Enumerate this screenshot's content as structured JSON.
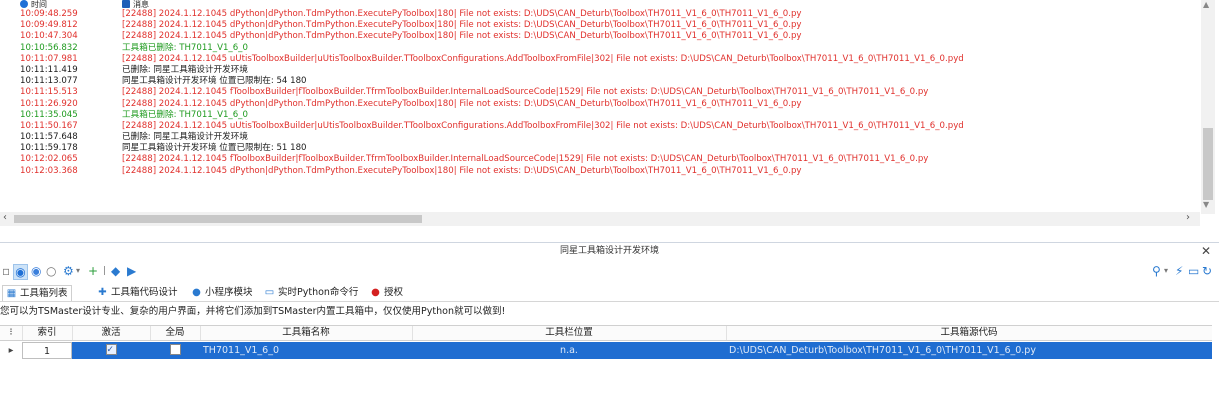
{
  "log": {
    "header_time": "时间",
    "header_msg": "消息",
    "lines": [
      {
        "time": "10:09:48.259",
        "msg": "[22488] 2024.1.12.1045 dPython|dPython.TdmPython.ExecutePyToolbox|180| File not exists: D:\\UDS\\CAN_Deturb\\Toolbox\\TH7011_V1_6_0\\TH7011_V1_6_0.py",
        "level": "red"
      },
      {
        "time": "10:09:49.812",
        "msg": "[22488] 2024.1.12.1045 dPython|dPython.TdmPython.ExecutePyToolbox|180| File not exists: D:\\UDS\\CAN_Deturb\\Toolbox\\TH7011_V1_6_0\\TH7011_V1_6_0.py",
        "level": "red"
      },
      {
        "time": "10:10:47.304",
        "msg": "[22488] 2024.1.12.1045 dPython|dPython.TdmPython.ExecutePyToolbox|180| File not exists: D:\\UDS\\CAN_Deturb\\Toolbox\\TH7011_V1_6_0\\TH7011_V1_6_0.py",
        "level": "red"
      },
      {
        "time": "10:10:56.832",
        "msg": "工具箱已删除: TH7011_V1_6_0",
        "level": "green"
      },
      {
        "time": "10:11:07.981",
        "msg": "[22488] 2024.1.12.1045 uUtisToolboxBuilder|uUtisToolboxBuilder.TToolboxConfigurations.AddToolboxFromFile|302| File not exists: D:\\UDS\\CAN_Deturb\\Toolbox\\TH7011_V1_6_0\\TH7011_V1_6_0.pyd",
        "level": "red"
      },
      {
        "time": "10:11:11.419",
        "msg": "已删除: 同星工具箱设计开发环境",
        "level": "black"
      },
      {
        "time": "10:11:13.077",
        "msg": "同星工具箱设计开发环境 位置已限制在: 54 180",
        "level": "black"
      },
      {
        "time": "10:11:15.513",
        "msg": "[22488] 2024.1.12.1045 fToolboxBuilder|fToolboxBuilder.TfrmToolboxBuilder.InternalLoadSourceCode|1529| File not exists: D:\\UDS\\CAN_Deturb\\Toolbox\\TH7011_V1_6_0\\TH7011_V1_6_0.py",
        "level": "red"
      },
      {
        "time": "10:11:26.920",
        "msg": "[22488] 2024.1.12.1045 dPython|dPython.TdmPython.ExecutePyToolbox|180| File not exists: D:\\UDS\\CAN_Deturb\\Toolbox\\TH7011_V1_6_0\\TH7011_V1_6_0.py",
        "level": "red"
      },
      {
        "time": "10:11:35.045",
        "msg": "工具箱已删除: TH7011_V1_6_0",
        "level": "green"
      },
      {
        "time": "10:11:50.167",
        "msg": "[22488] 2024.1.12.1045 uUtisToolboxBuilder|uUtisToolboxBuilder.TToolboxConfigurations.AddToolboxFromFile|302| File not exists: D:\\UDS\\CAN_Deturb\\Toolbox\\TH7011_V1_6_0\\TH7011_V1_6_0.pyd",
        "level": "red"
      },
      {
        "time": "10:11:57.648",
        "msg": "已删除: 同星工具箱设计开发环境",
        "level": "black"
      },
      {
        "time": "10:11:59.178",
        "msg": "同星工具箱设计开发环境 位置已限制在: 51 180",
        "level": "black"
      },
      {
        "time": "10:12:02.065",
        "msg": "[22488] 2024.1.12.1045 fToolboxBuilder|fToolboxBuilder.TfrmToolboxBuilder.InternalLoadSourceCode|1529| File not exists: D:\\UDS\\CAN_Deturb\\Toolbox\\TH7011_V1_6_0\\TH7011_V1_6_0.py",
        "level": "red"
      },
      {
        "time": "10:12:03.368",
        "msg": "[22488] 2024.1.12.1045 dPython|dPython.TdmPython.ExecutePyToolbox|180| File not exists: D:\\UDS\\CAN_Deturb\\Toolbox\\TH7011_V1_6_0\\TH7011_V1_6_0.py",
        "level": "red"
      }
    ]
  },
  "panel": {
    "title": "同星工具箱设计开发环境",
    "tabs": [
      {
        "label": "工具箱列表",
        "icon": "toolbox-icon",
        "active": true
      },
      {
        "label": "工具箱代码设计",
        "icon": "puzzle-icon",
        "active": false
      },
      {
        "label": "小程序模块",
        "icon": "module-icon",
        "active": false
      },
      {
        "label": "实时Python命令行",
        "icon": "terminal-icon",
        "active": false
      },
      {
        "label": "授权",
        "icon": "license-icon",
        "active": false
      }
    ],
    "description": "您可以为TSMaster设计专业、复杂的用户界面，并将它们添加到TSMaster内置工具箱中，仅仅使用Python就可以做到!",
    "columns": [
      "索引",
      "激活",
      "全局",
      "工具箱名称",
      "工具栏位置",
      "工具箱源代码"
    ],
    "rows": [
      {
        "index": "1",
        "active": true,
        "global": false,
        "name": "TH7011_V1_6_0",
        "position": "n.a.",
        "source": "D:\\UDS\\CAN_Deturb\\Toolbox\\TH7011_V1_6_0\\TH7011_V1_6_0.py"
      }
    ]
  },
  "colors": {
    "error": "#e0302c",
    "success": "#1e9a1e",
    "selection": "#1f6dd1"
  }
}
